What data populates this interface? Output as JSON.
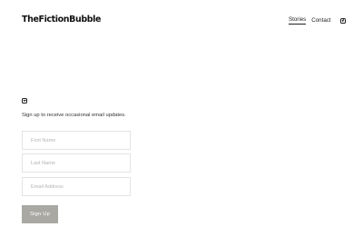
{
  "header": {
    "logo": "TheFictionBubble",
    "nav": [
      {
        "label": "Stories",
        "active": true
      },
      {
        "label": "Contact",
        "active": false
      }
    ],
    "social_icon": "instagram-icon"
  },
  "newsletter": {
    "social_icon": "instagram-icon",
    "prompt": "Sign up to receive occasional email updates.",
    "first_name_placeholder": "First Name",
    "last_name_placeholder": "Last Name",
    "email_placeholder": "Email Address",
    "submit_label": "Sign Up",
    "button_color": "#a9a8a3"
  }
}
